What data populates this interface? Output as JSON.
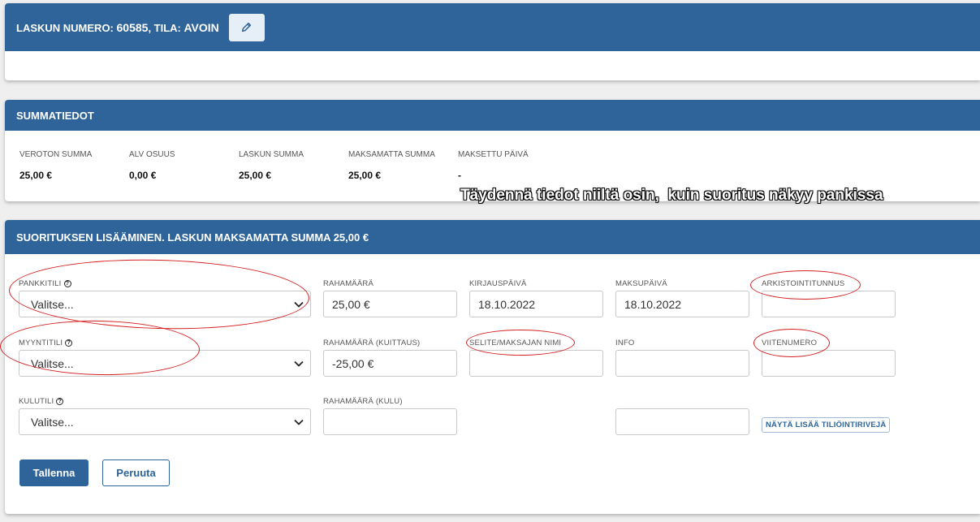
{
  "header": {
    "title_prefix": "LASKUN NUMERO: ",
    "number": "60585",
    "state_prefix": ", TILA: ",
    "state": "AVOIN",
    "edit_icon": "pencil-icon"
  },
  "summary": {
    "title": "SUMMATIEDOT",
    "items": [
      {
        "label": "VEROTON SUMMA",
        "value": "25,00 €"
      },
      {
        "label": "ALV OSUUS",
        "value": "0,00 €"
      },
      {
        "label": "LASKUN SUMMA",
        "value": "25,00 €"
      },
      {
        "label": "MAKSAMATTA SUMMA",
        "value": "25,00 €"
      },
      {
        "label": "MAKSETTU PÄIVÄ",
        "value": "-"
      }
    ]
  },
  "annotation": "Täydennä tiedot niiltä osin,  kuin suoritus näkyy pankissa",
  "payment": {
    "title": "SUORITUKSEN LISÄÄMINEN. LASKUN MAKSAMATTA SUMMA 25,00 €",
    "pankkitili": {
      "label": "PANKKITILI",
      "value": "Valitse..."
    },
    "myyntitili": {
      "label": "MYYNTITILI",
      "value": "Valitse..."
    },
    "kulutili": {
      "label": "KULUTILI",
      "value": "Valitse..."
    },
    "rahamaara": {
      "label": "RAHAMÄÄRÄ",
      "value": "25,00 €"
    },
    "rahamaara_kuittaus": {
      "label": "RAHAMÄÄRÄ (KUITTAUS)",
      "value": "-25,00 €"
    },
    "rahamaara_kulu": {
      "label": "RAHAMÄÄRÄ (KULU)",
      "value": ""
    },
    "kirjauspaiva": {
      "label": "KIRJAUSPÄIVÄ",
      "value": "18.10.2022"
    },
    "selite": {
      "label": "SELITE/MAKSAJAN NIMI",
      "value": ""
    },
    "maksupaiva": {
      "label": "MAKSUPÄIVÄ",
      "value": "18.10.2022"
    },
    "info": {
      "label": "INFO",
      "value": ""
    },
    "extra": {
      "value": ""
    },
    "arkistointitunnus": {
      "label": "ARKISTOINTITUNNUS",
      "value": ""
    },
    "viitenumero": {
      "label": "VIITENUMERO",
      "value": ""
    },
    "show_more": "NÄYTÄ LISÄÄ TILIÖINTIRIVEJÄ",
    "save": "Tallenna",
    "cancel": "Peruuta"
  }
}
